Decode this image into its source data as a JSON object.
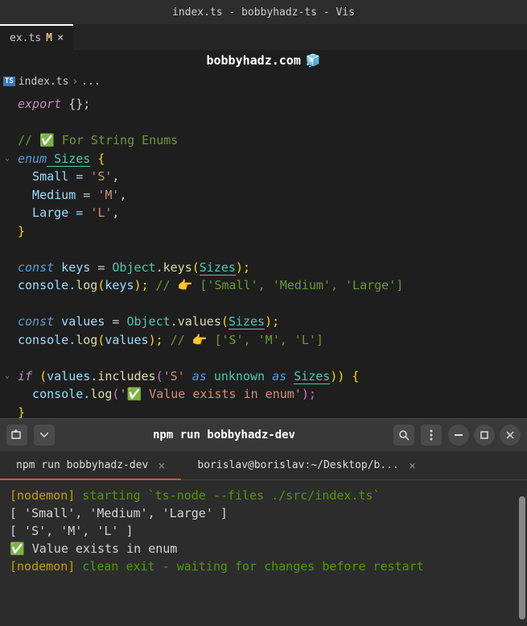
{
  "window": {
    "title": "index.ts - bobbyhadz-ts - Vis"
  },
  "tab": {
    "name": "ex.ts",
    "modified": "M"
  },
  "banner": {
    "text": "bobbyhadz.com",
    "icon": "🧊"
  },
  "breadcrumb": {
    "file": "index.ts",
    "sep": "›",
    "more": "..."
  },
  "code": {
    "l1a": "export",
    "l1b": " {};",
    "l3": "// ✅ For String Enums",
    "l4a": "enum",
    "l4b": " Sizes",
    "l4c": " {",
    "l5a": "  Small = ",
    "l5b": "'S'",
    "l5c": ",",
    "l6a": "  Medium = ",
    "l6b": "'M'",
    "l6c": ",",
    "l7a": "  Large = ",
    "l7b": "'L'",
    "l7c": ",",
    "l8": "}",
    "l10a": "const",
    "l10b": " keys",
    "l10c": " = ",
    "l10d": "Object",
    "l10e": ".",
    "l10f": "keys",
    "l10g": "(",
    "l10h": "Sizes",
    "l10i": ");",
    "l11a": "console.",
    "l11b": "log",
    "l11c": "(",
    "l11d": "keys",
    "l11e": "); ",
    "l11f": "// 👉️ ['Small', 'Medium', 'Large']",
    "l13a": "const",
    "l13b": " values",
    "l13c": " = ",
    "l13d": "Object",
    "l13e": ".",
    "l13f": "values",
    "l13g": "(",
    "l13h": "Sizes",
    "l13i": ");",
    "l14a": "console.",
    "l14b": "log",
    "l14c": "(",
    "l14d": "values",
    "l14e": "); ",
    "l14f": "// 👉️ ['S', 'M', 'L']",
    "l16a": "if",
    "l16b": " (",
    "l16c": "values",
    "l16d": ".",
    "l16e": "includes",
    "l16f": "(",
    "l16g": "'S'",
    "l16h": " as ",
    "l16i": "unknown",
    "l16j": " as ",
    "l16k": "Sizes",
    "l16l": ")) {",
    "l17a": "  console.",
    "l17b": "log",
    "l17c": "(",
    "l17d": "'✅ Value exists in enum'",
    "l17e": ");",
    "l18": "}"
  },
  "terminal": {
    "title": "npm run bobbyhadz-dev",
    "tabs": [
      {
        "label": "npm run bobbyhadz-dev"
      },
      {
        "label": "borislav@borislav:~/Desktop/b..."
      }
    ],
    "out1a": "[nodemon]",
    "out1b": " starting `ts-node --files ./src/index.ts`",
    "out2": "[ 'Small', 'Medium', 'Large' ]",
    "out3": "[ 'S', 'M', 'L' ]",
    "out4": "✅ Value exists in enum",
    "out5a": "[nodemon]",
    "out5b": " clean exit - waiting for changes before restart"
  }
}
